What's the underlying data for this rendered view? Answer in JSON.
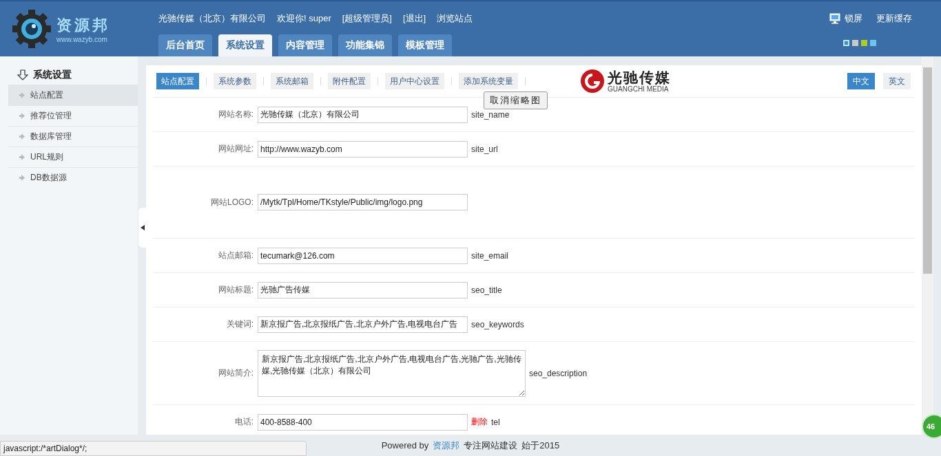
{
  "header": {
    "logo": {
      "name": "资源邦",
      "url": "www.wazyb.com"
    },
    "company": "光驰传媒（北京）有限公司",
    "welcome": "欢迎你! super",
    "role": "[超级管理员]",
    "logout": "[退出]",
    "browse": "浏览站点",
    "actions": [
      {
        "label": "锁屏",
        "kind": "lock"
      },
      {
        "label": "更新缓存",
        "kind": "plain"
      }
    ],
    "tabs": [
      {
        "label": "后台首页",
        "selected": false
      },
      {
        "label": "系统设置",
        "selected": true
      },
      {
        "label": "内容管理",
        "selected": false
      },
      {
        "label": "功能集锦",
        "selected": false
      },
      {
        "label": "模板管理",
        "selected": false
      }
    ],
    "themes": [
      {
        "color": "#3a8fc4",
        "selected": true
      },
      {
        "color": "#c8c8c8",
        "selected": false
      },
      {
        "color": "#a8d020",
        "selected": false
      },
      {
        "color": "#6cc4f0",
        "selected": false
      }
    ]
  },
  "sidebar": {
    "title": "系统设置",
    "items": [
      {
        "label": "站点配置",
        "selected": true
      },
      {
        "label": "推荐位管理",
        "selected": false
      },
      {
        "label": "数据库管理",
        "selected": false
      },
      {
        "label": "URL规则",
        "selected": false
      },
      {
        "label": "DB数据源",
        "selected": false
      }
    ]
  },
  "subtabs": [
    {
      "label": "站点配置",
      "selected": true
    },
    {
      "label": "系统参数",
      "selected": false
    },
    {
      "label": "系统邮箱",
      "selected": false
    },
    {
      "label": "附件配置",
      "selected": false
    },
    {
      "label": "用户中心设置",
      "selected": false
    },
    {
      "label": "添加系统变量",
      "selected": false
    }
  ],
  "brand": {
    "name": "光驰传媒",
    "en": "GUANGCHI MEDIA"
  },
  "languages": [
    {
      "label": "中文",
      "selected": true
    },
    {
      "label": "英文",
      "selected": false
    }
  ],
  "tooltip": "取消缩略图",
  "fields": [
    {
      "label": "网站名称:",
      "kind": "input",
      "value": "光驰传媒（北京）有限公司",
      "key": "site_name"
    },
    {
      "label": "网站网址:",
      "kind": "input",
      "value": "http://www.wazyb.com",
      "key": "site_url"
    },
    {
      "label": "网站LOGO:",
      "kind": "logo",
      "value": "/Mytk/Tpl/Home/TKstyle/Public/img/logo.png"
    },
    {
      "label": "站点邮箱:",
      "kind": "input",
      "value": "tecumark@126.com",
      "key": "site_email"
    },
    {
      "label": "网站标题:",
      "kind": "input",
      "value": "光驰广告传媒",
      "key": "seo_title"
    },
    {
      "label": "关键词:",
      "kind": "input",
      "value": "新京报广告,北京报纸广告,北京户外广告,电视电台广告",
      "key": "seo_keywords"
    },
    {
      "label": "网站简介:",
      "kind": "textarea",
      "value": "新京报广告,北京报纸广告,北京户外广告,电视电台广告,光驰广告,光驰传媒,光驰传媒（北京）有限公司",
      "key": "seo_description"
    },
    {
      "label": "电话:",
      "kind": "input",
      "value": "400-8588-400",
      "delete": "删除",
      "key": "tel"
    }
  ],
  "footer": {
    "powered": "Powered by",
    "link": "资源邦",
    "slogan": "专注网站建设",
    "since": "始于2015"
  },
  "status_text": "javascript:/*artDialog*/;",
  "badge": "46"
}
